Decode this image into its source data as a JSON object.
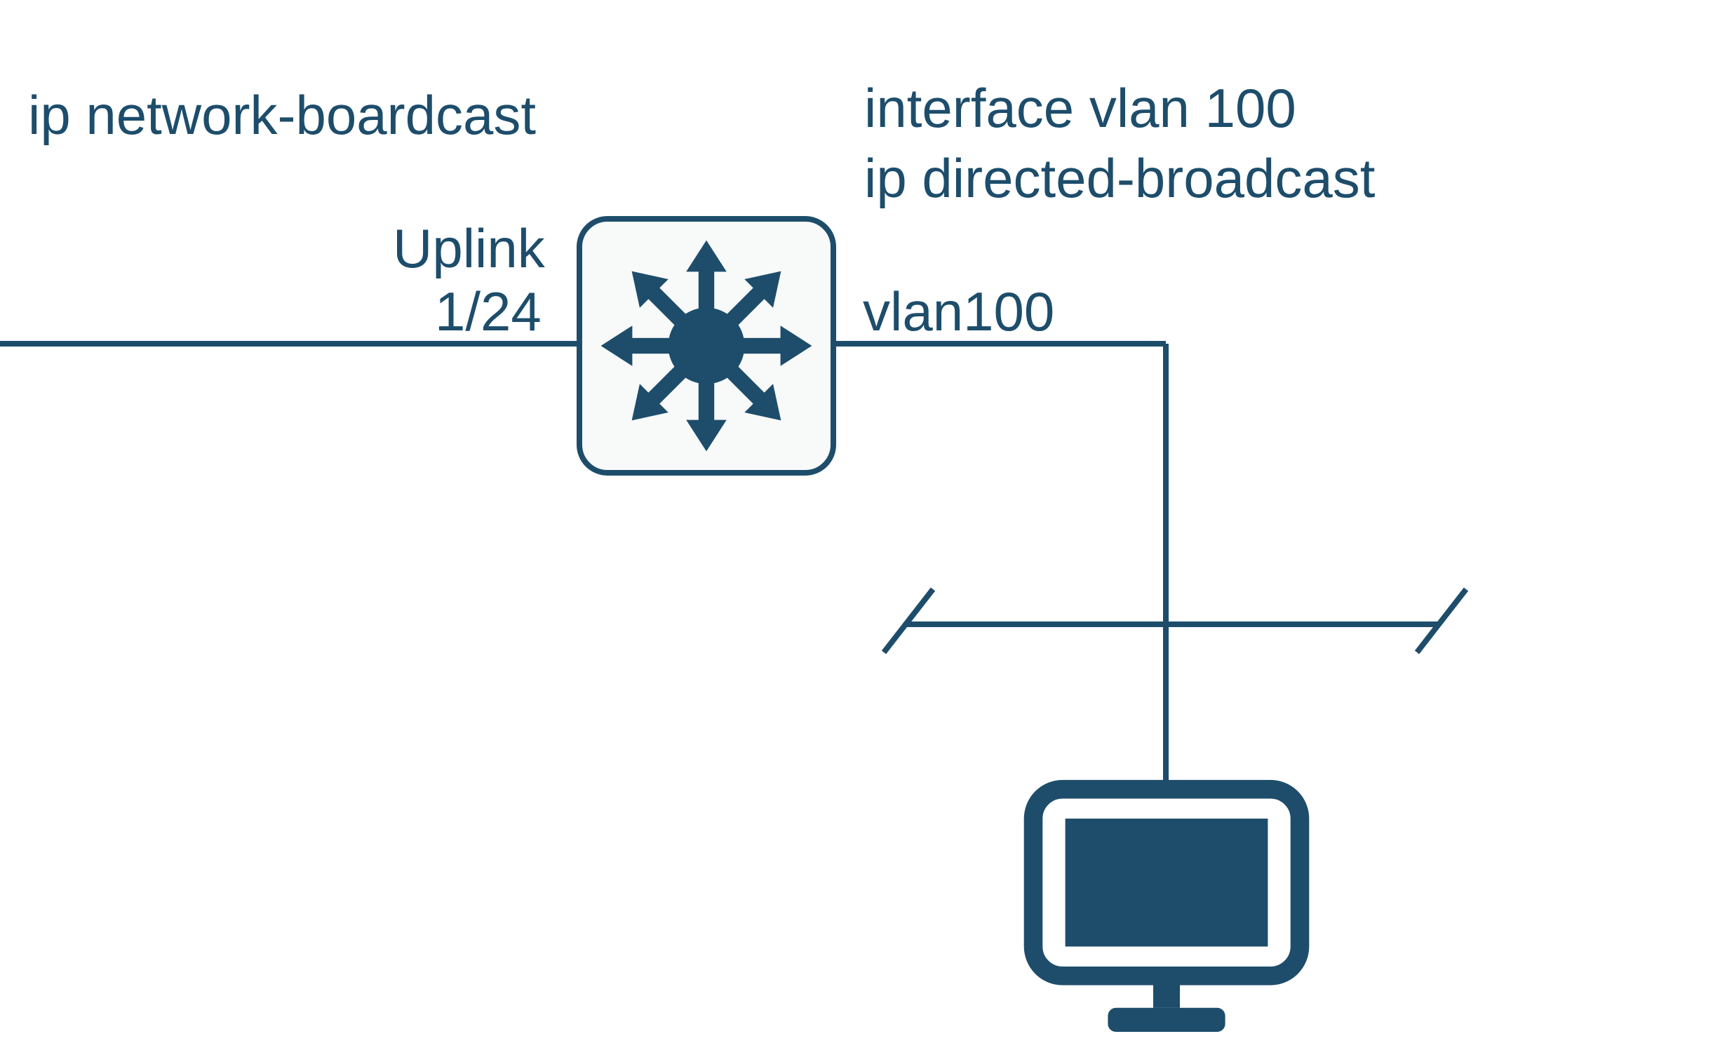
{
  "labels": {
    "left_cmd": "ip network-boardcast",
    "right_cmd_line1": "interface vlan 100",
    "right_cmd_line2": "ip directed-broadcast",
    "uplink": "Uplink",
    "uplink_port": "1/24",
    "vlan": "vlan100"
  },
  "colors": {
    "ink": "#1d4d6b",
    "box_bg": "#f8f9f9"
  }
}
